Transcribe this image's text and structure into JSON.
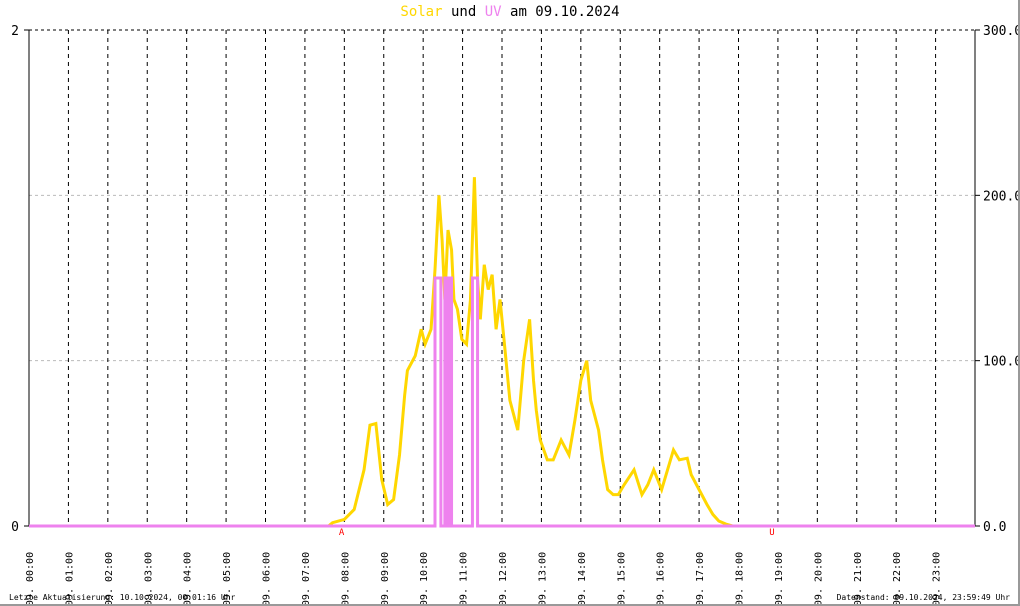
{
  "title": {
    "solar": "Solar",
    "und": "und",
    "uv": "UV",
    "rest": "am 09.10.2024"
  },
  "colors": {
    "solar": "#FFD700",
    "uv": "#EE82EE",
    "marker": "#FF0000",
    "grid": "#000000",
    "grid_minor": "#BBBBBB"
  },
  "footer": {
    "left": "Letzte Aktualisierung: 10.10.2024, 00:01:16 Uhr",
    "right": "Datenstand: 09.10.2024, 23:59:49 Uhr"
  },
  "chart_data": {
    "type": "line",
    "title": "Solar und UV am 09.10.2024",
    "xlim": [
      0,
      24
    ],
    "y_left": {
      "lim": [
        0,
        2
      ],
      "ticks": [
        "0",
        "2"
      ]
    },
    "y_right": {
      "lim": [
        0,
        300
      ],
      "ticks": [
        "0.0",
        "100.0",
        "200.0",
        "300.0"
      ]
    },
    "x_tick_labels": [
      "09. 00:00",
      "09. 01:00",
      "09. 02:00",
      "09. 03:00",
      "09. 04:00",
      "09. 05:00",
      "09. 06:00",
      "09. 07:00",
      "09. 08:00",
      "09. 09:00",
      "09. 10:00",
      "09. 11:00",
      "09. 12:00",
      "09. 13:00",
      "09. 14:00",
      "09. 15:00",
      "09. 16:00",
      "09. 17:00",
      "09. 18:00",
      "09. 19:00",
      "09. 20:00",
      "09. 21:00",
      "09. 22:00",
      "09. 23:00"
    ],
    "markers": [
      {
        "label": "A",
        "hour": 7.93
      },
      {
        "label": "U",
        "hour": 18.85
      }
    ],
    "series": [
      {
        "name": "Solar",
        "axis": "right",
        "x": [
          0,
          7.6,
          7.7,
          8.0,
          8.25,
          8.5,
          8.65,
          8.8,
          8.95,
          9.1,
          9.25,
          9.4,
          9.53,
          9.6,
          9.8,
          9.95,
          10.05,
          10.2,
          10.3,
          10.4,
          10.48,
          10.55,
          10.63,
          10.72,
          10.78,
          10.87,
          10.98,
          11.1,
          11.2,
          11.3,
          11.38,
          11.45,
          11.55,
          11.65,
          11.75,
          11.85,
          11.95,
          12.05,
          12.2,
          12.4,
          12.55,
          12.7,
          12.8,
          12.87,
          12.97,
          13.15,
          13.3,
          13.5,
          13.7,
          13.85,
          14.0,
          14.15,
          14.25,
          14.45,
          14.55,
          14.68,
          14.82,
          14.95,
          15.1,
          15.35,
          15.55,
          15.7,
          15.85,
          16.05,
          16.2,
          16.35,
          16.5,
          16.7,
          16.8,
          17.0,
          17.2,
          17.35,
          17.5,
          17.7,
          17.85,
          18.0,
          18.1,
          24
        ],
        "values": [
          0,
          0,
          2,
          4,
          10,
          34,
          61,
          62,
          28,
          13,
          16,
          43,
          79,
          94,
          103,
          119,
          110,
          119,
          155,
          200,
          173,
          137,
          179,
          167,
          137,
          131,
          113,
          110,
          137,
          211,
          149,
          125,
          158,
          143,
          152,
          119,
          137,
          113,
          76,
          58,
          100,
          125,
          88,
          70,
          52,
          40,
          40,
          52,
          43,
          64,
          88,
          100,
          76,
          58,
          40,
          22,
          19,
          19,
          25,
          34,
          19,
          25,
          34,
          22,
          34,
          46,
          40,
          41,
          31,
          22,
          13,
          7,
          3,
          1,
          0,
          0,
          0,
          0
        ]
      },
      {
        "name": "UV",
        "axis": "left",
        "step": true,
        "x": [
          0,
          10.3,
          10.45,
          10.55,
          10.6,
          10.66,
          10.72,
          10.78,
          11.25,
          11.38,
          24
        ],
        "values": [
          0,
          1,
          0,
          1,
          0,
          1,
          0,
          0,
          1,
          0,
          0
        ]
      }
    ]
  }
}
